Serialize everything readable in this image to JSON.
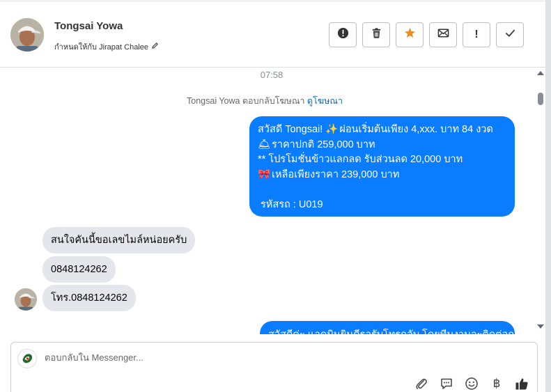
{
  "header": {
    "contact_name": "Tongsai Yowa",
    "assigned_to": "กำหนดให้กับ Jirapat Chalee",
    "actions": [
      {
        "name": "report-spam-button",
        "icon": "exclamation-circle-icon"
      },
      {
        "name": "delete-button",
        "icon": "trash-icon"
      },
      {
        "name": "star-button",
        "icon": "star-icon"
      },
      {
        "name": "mark-unread-button",
        "icon": "envelope-icon"
      },
      {
        "name": "follow-up-button",
        "icon": "exclamation-icon"
      },
      {
        "name": "mark-done-button",
        "icon": "check-icon"
      }
    ]
  },
  "conversation": {
    "timestamp": "07:58",
    "ad_reply_text": "Tongsai Yowa ตอบกลับโฆษณา",
    "ad_reply_link": "ดูโฆษณา",
    "outgoing_1": {
      "line1_text": "สวัสดี Tongsai! ",
      "line1_emoji": "✨",
      "line1_rest": " ผ่อนเริ่มต้นเพียง 4,xxx. บาท 84 งวด",
      "line2_emoji": "🛎",
      "line2_text": " ราคาปกติ 259,000 บาท",
      "line3_text": "** โปรโมชั่นข้าวแลกลด รับส่วนลด 20,000 บาท",
      "line4_emoji": "🎀",
      "line4_text": " เหลือเพียงราคา 239,000 บาท",
      "line6_text": "รหัสรถ : U019"
    },
    "incoming": [
      {
        "text": "สนใจคันนี้ขอเลขไมล์หน่อยครับ"
      },
      {
        "text": "0848124262"
      },
      {
        "text": "โทร.0848124262"
      }
    ],
    "outgoing_2_partial": "สวัสดีค่ะ แอดมินยินดีรอรับโทรกลับ โดยทีมงานจะติดต่อกลับค่ะ"
  },
  "composer": {
    "placeholder": "ตอบกลับใน Messenger...",
    "tools": [
      "attach-icon",
      "saved-reply-icon",
      "emoji-icon",
      "baht-icon",
      "like-icon"
    ],
    "baht_symbol": "฿"
  },
  "colors": {
    "outgoing_bubble": "#0a7cff",
    "incoming_bubble": "#e4e6eb",
    "star": "#f08c1e",
    "link": "#0a66c2"
  }
}
